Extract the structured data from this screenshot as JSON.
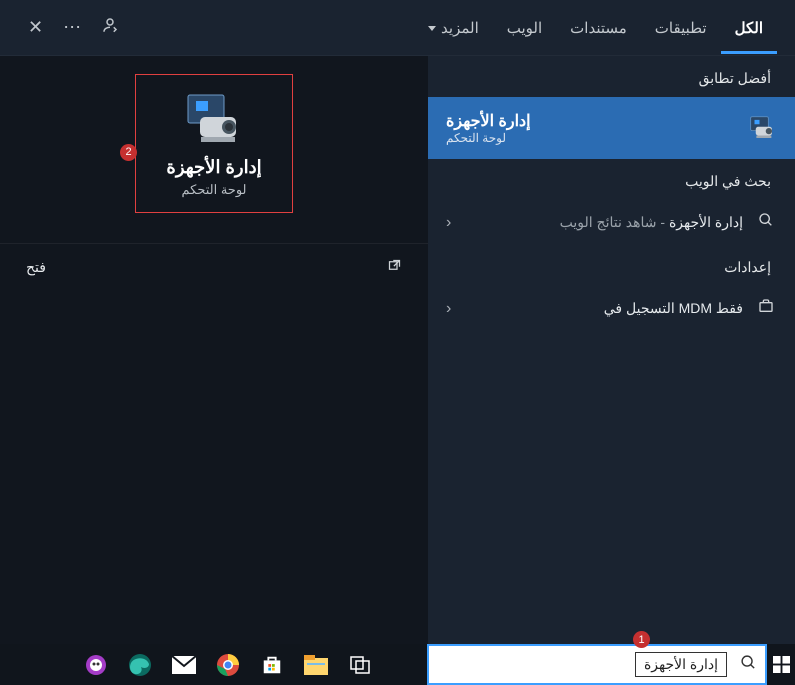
{
  "tabs": {
    "all": "الكل",
    "apps": "تطبيقات",
    "docs": "مستندات",
    "web": "الويب",
    "more": "المزيد"
  },
  "top_icons": {
    "feedback": "feedback",
    "more": "more",
    "close": "close"
  },
  "sidebar": {
    "best_match_label": "أفضل تطابق",
    "match": {
      "title": "إدارة الأجهزة",
      "subtitle": "لوحة التحكم"
    },
    "web_section": "بحث في الويب",
    "web_item_primary": "إدارة الأجهزة",
    "web_item_secondary": " - شاهد نتائج الويب",
    "settings_section": "إعدادات",
    "settings_item": "فقط MDM التسجيل في"
  },
  "preview": {
    "title": "إدارة الأجهزة",
    "subtitle": "لوحة التحكم",
    "open_label": "فتح",
    "badge": "2"
  },
  "search": {
    "value": "إدارة الأجهزة",
    "badge": "1"
  }
}
